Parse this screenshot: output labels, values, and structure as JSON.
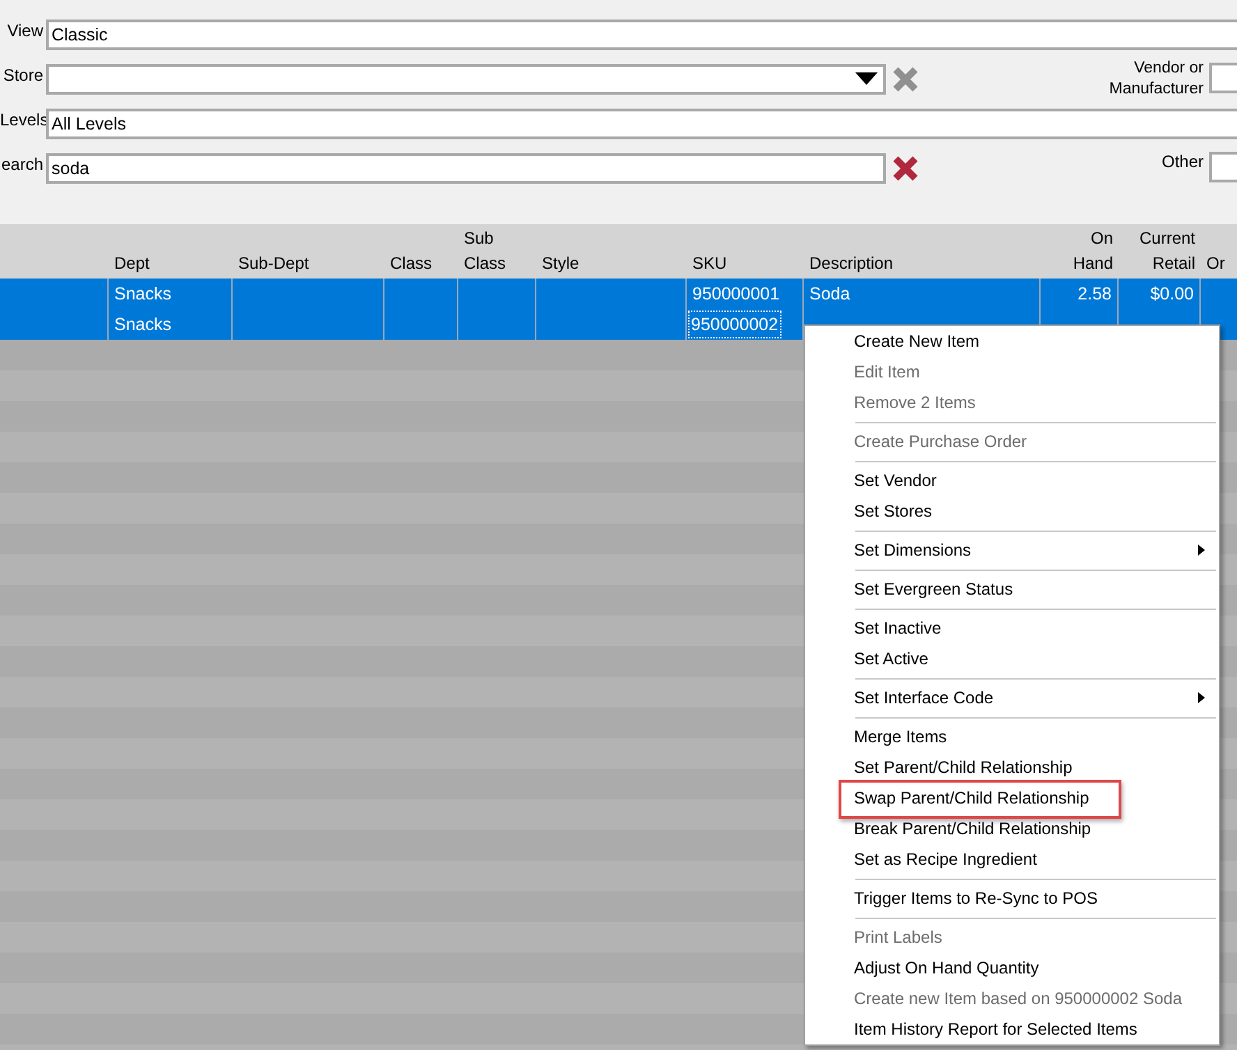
{
  "filters": [
    {
      "label": "View",
      "kind": "text",
      "value": "Classic"
    },
    {
      "label": "Store",
      "kind": "dropdown",
      "has_clear": true,
      "clear_enabled": false,
      "side_label": "Vendor or Manufacturer"
    },
    {
      "label": "Levels",
      "kind": "text",
      "value": "All Levels"
    },
    {
      "label": "earch",
      "kind": "text",
      "value": "soda",
      "has_clear": true,
      "clear_enabled": true,
      "side_label": "Other"
    }
  ],
  "table": {
    "columns": [
      "",
      "Dept",
      "Sub-Dept",
      "Class",
      "Sub Class",
      "Style",
      "SKU",
      "Description",
      "On Hand",
      "Current Retail",
      "Or"
    ],
    "rows": [
      {
        "selected": true,
        "sku_focused": false,
        "cells": [
          null,
          "Snacks",
          null,
          null,
          null,
          null,
          "950000001",
          "Soda",
          "2.58",
          "$0.00",
          null
        ]
      },
      {
        "selected": true,
        "sku_focused": true,
        "cells": [
          null,
          "Snacks",
          null,
          null,
          null,
          null,
          "950000002",
          null,
          null,
          null,
          null
        ]
      }
    ]
  },
  "context_menu": [
    {
      "kind": "item",
      "label": "Create New Item",
      "disabled": false
    },
    {
      "kind": "item",
      "label": "Edit Item",
      "disabled": true
    },
    {
      "kind": "item",
      "label": "Remove 2 Items",
      "disabled": true
    },
    {
      "kind": "separator"
    },
    {
      "kind": "item",
      "label": "Create Purchase Order",
      "disabled": true
    },
    {
      "kind": "separator"
    },
    {
      "kind": "item",
      "label": "Set Vendor",
      "disabled": false
    },
    {
      "kind": "item",
      "label": "Set Stores",
      "disabled": false
    },
    {
      "kind": "separator"
    },
    {
      "kind": "item",
      "label": "Set Dimensions",
      "disabled": false,
      "submenu": true
    },
    {
      "kind": "separator"
    },
    {
      "kind": "item",
      "label": "Set Evergreen Status",
      "disabled": false
    },
    {
      "kind": "separator"
    },
    {
      "kind": "item",
      "label": "Set Inactive",
      "disabled": false
    },
    {
      "kind": "item",
      "label": "Set Active",
      "disabled": false
    },
    {
      "kind": "separator"
    },
    {
      "kind": "item",
      "label": "Set Interface Code",
      "disabled": false,
      "submenu": true
    },
    {
      "kind": "separator"
    },
    {
      "kind": "item",
      "label": "Merge Items",
      "disabled": false
    },
    {
      "kind": "item",
      "label": "Set Parent/Child Relationship",
      "disabled": false
    },
    {
      "kind": "item",
      "label": "Swap Parent/Child Relationship",
      "disabled": false,
      "highlighted": true
    },
    {
      "kind": "item",
      "label": "Break Parent/Child Relationship",
      "disabled": false
    },
    {
      "kind": "item",
      "label": "Set as Recipe Ingredient",
      "disabled": false
    },
    {
      "kind": "separator"
    },
    {
      "kind": "item",
      "label": "Trigger Items to Re-Sync to POS",
      "disabled": false
    },
    {
      "kind": "separator"
    },
    {
      "kind": "item",
      "label": "Print Labels",
      "disabled": true
    },
    {
      "kind": "item",
      "label": "Adjust On Hand Quantity",
      "disabled": false
    },
    {
      "kind": "item",
      "label": "Create new Item based on 950000002 Soda",
      "disabled": true
    },
    {
      "kind": "item",
      "label": "Item History Report for Selected Items",
      "disabled": false
    }
  ]
}
